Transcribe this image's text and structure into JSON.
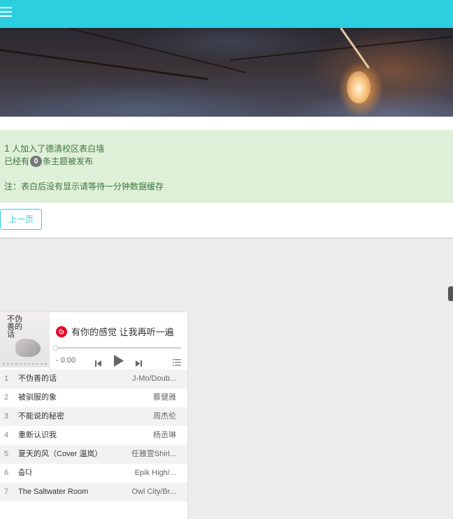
{
  "notice": {
    "joined_count": "1",
    "joined_text": " 人加入了德清校区表白墙",
    "posts_prefix": "已经有",
    "posts_count": "0",
    "posts_suffix": "条主题被发布",
    "note": "注：表白后没有显示请等待一分钟数据缓存"
  },
  "pager": {
    "prev_label": "上一页"
  },
  "player": {
    "cover_text": "不伪善的话",
    "now_playing": "有你的感觉 让我再听一遍",
    "time": "- 0:00",
    "playlist": [
      {
        "idx": "1",
        "name": "不伪善的话",
        "artist": "J-Mo/Doub..."
      },
      {
        "idx": "2",
        "name": "被驯服的象",
        "artist": "蔡健雅"
      },
      {
        "idx": "3",
        "name": "不能说的秘密",
        "artist": "周杰伦"
      },
      {
        "idx": "4",
        "name": "重新认识我",
        "artist": "杨丞琳"
      },
      {
        "idx": "5",
        "name": "夏天的风（Cover 温岚）",
        "artist": "任雅萱Shirl..."
      },
      {
        "idx": "6",
        "name": "춥다",
        "artist": "Epik High/..."
      },
      {
        "idx": "7",
        "name": "The Saltwater Room",
        "artist": "Owl City/Br..."
      }
    ]
  },
  "colors": {
    "accent": "#2ccfdf",
    "notice_bg": "#dff0d8",
    "notice_text": "#3c763d",
    "netease_red": "#e60026"
  },
  "icons": {
    "menu": "hamburger-menu-icon",
    "netease": "netease-music-icon",
    "prev": "skip-previous-icon",
    "play": "play-icon",
    "next": "skip-next-icon",
    "playlist": "playlist-icon"
  }
}
